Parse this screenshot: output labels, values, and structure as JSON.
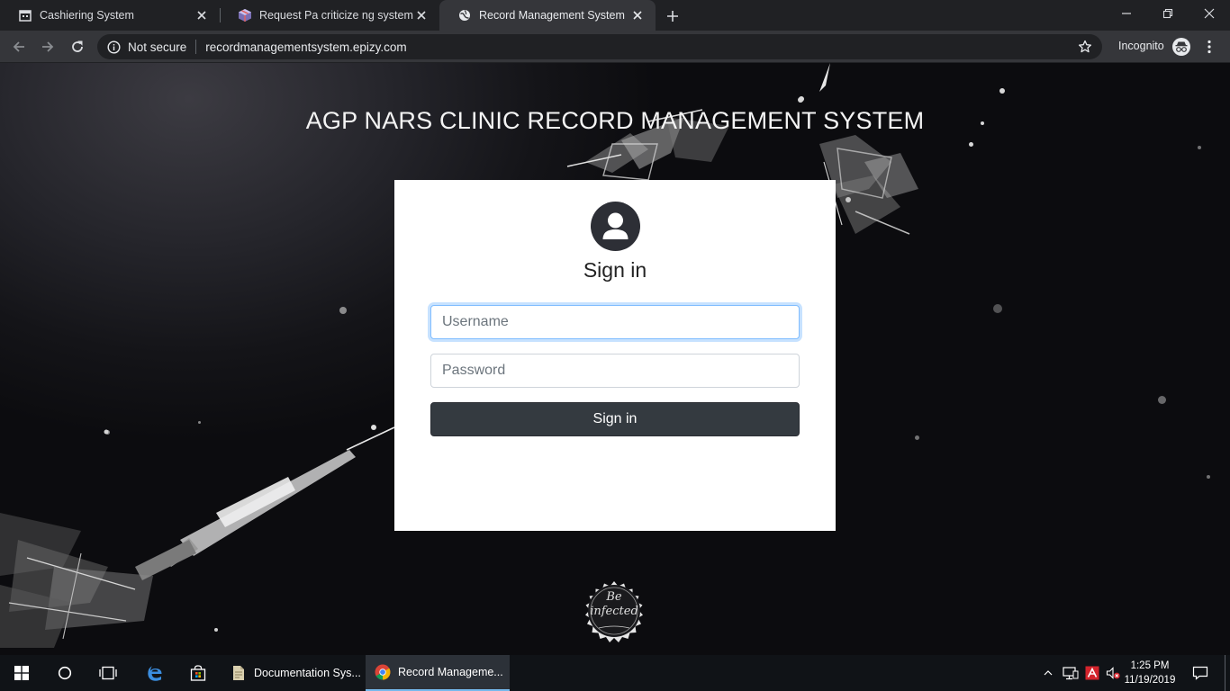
{
  "browser": {
    "tabs": [
      {
        "title": "Cashiering System",
        "icon": "calendar-icon",
        "active": false
      },
      {
        "title": "Request Pa criticize ng system fo",
        "icon": "package-icon",
        "active": false
      },
      {
        "title": "Record Management System",
        "icon": "globe-icon",
        "active": true
      }
    ],
    "security_label": "Not secure",
    "url": "recordmanagementsystem.epizy.com",
    "incognito_label": "Incognito"
  },
  "page": {
    "title": "AGP NARS CLINIC RECORD MANAGEMENT SYSTEM",
    "login": {
      "heading": "Sign in",
      "username_placeholder": "Username",
      "username_value": "",
      "password_placeholder": "Password",
      "password_value": "",
      "submit_label": "Sign in"
    },
    "seal_text_line1": "Be",
    "seal_text_line2": "infected"
  },
  "taskbar": {
    "apps": [
      {
        "label": "Documentation Sys...",
        "icon": "document-icon",
        "active": false
      },
      {
        "label": "Record Manageme...",
        "icon": "chrome-icon",
        "active": true
      }
    ],
    "clock_time": "1:25 PM",
    "clock_date": "11/19/2019"
  },
  "colors": {
    "tabstrip": "#202124",
    "toolbar": "#35363a",
    "card": "#ffffff",
    "button": "#343a40",
    "focus": "#80bdff",
    "taskbar": "#101317"
  }
}
